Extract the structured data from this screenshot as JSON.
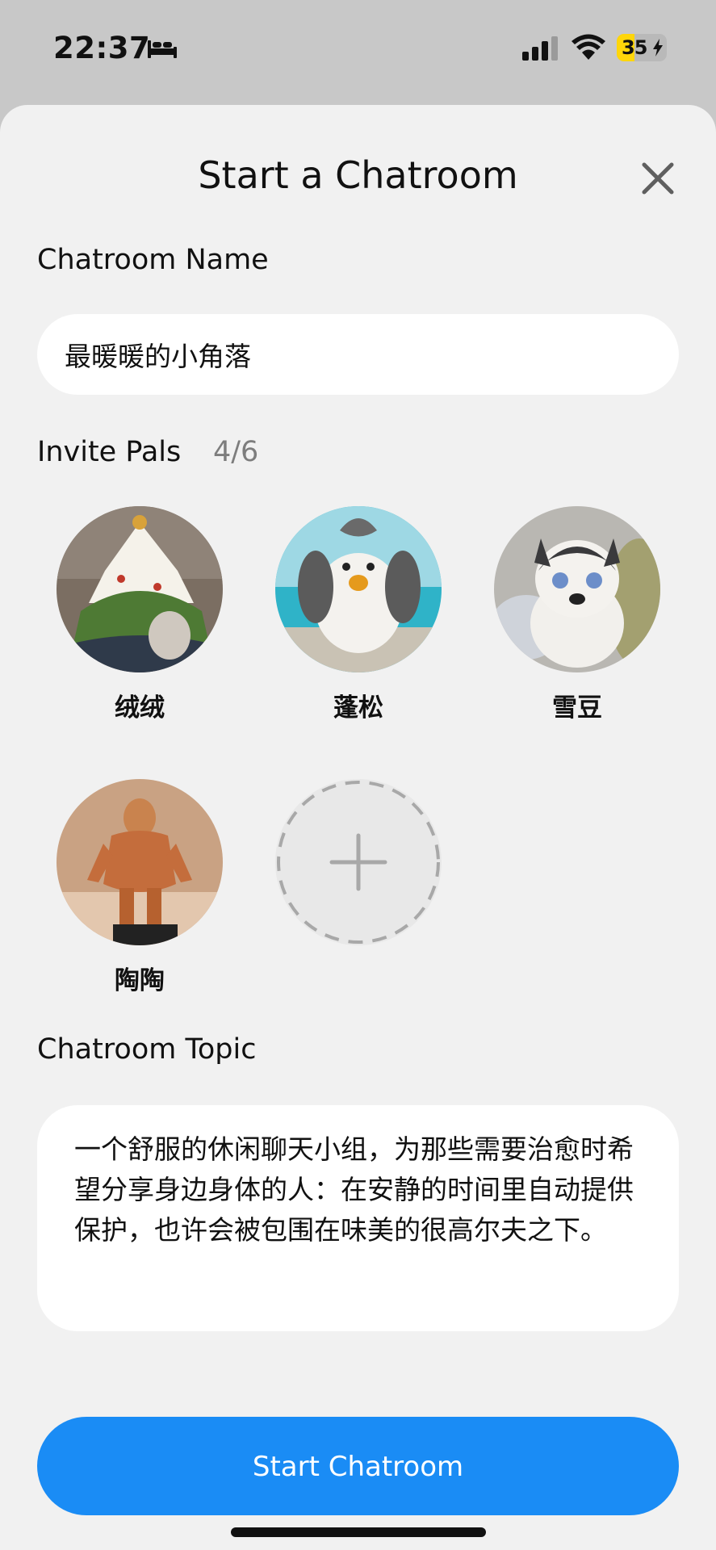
{
  "status_bar": {
    "time": "22:37",
    "battery_level": "35",
    "battery_percent": 35,
    "battery_color": "#ffd60a"
  },
  "sheet": {
    "title": "Start a Chatroom",
    "close_icon": "close-icon"
  },
  "chatroom_name": {
    "label": "Chatroom Name",
    "value": "最暖暖的小角落"
  },
  "invite": {
    "label": "Invite Pals",
    "count": "4/6",
    "pals": [
      {
        "name": "绒绒",
        "avatar": "knitted-tree-house"
      },
      {
        "name": "蓬松",
        "avatar": "fluffy-bird-plush"
      },
      {
        "name": "雪豆",
        "avatar": "husky-plush"
      },
      {
        "name": "陶陶",
        "avatar": "clay-figurine"
      }
    ],
    "add_icon": "plus-icon"
  },
  "topic": {
    "label": "Chatroom Topic",
    "value": "一个舒服的休闲聊天小组，为那些需要治愈时希望分享身边身体的人：在安静的时间里自动提供保护，也许会被包围在味美的很高尔夫之下。"
  },
  "actions": {
    "start_label": "Start Chatroom",
    "accent_color": "#1a8cf5"
  }
}
